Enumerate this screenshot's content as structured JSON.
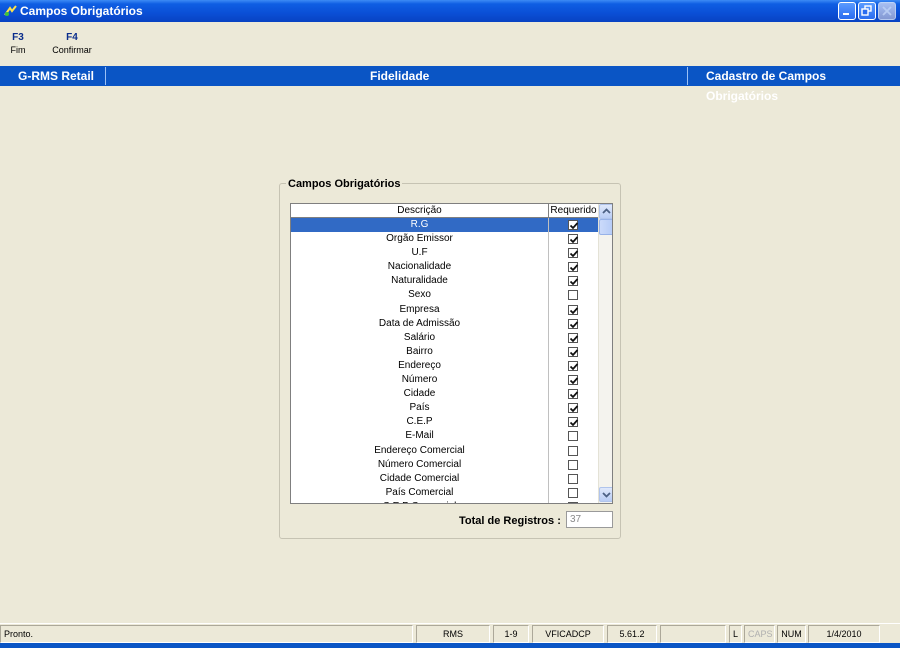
{
  "window": {
    "title": "Campos Obrigatórios",
    "controls": [
      "minimize",
      "maximize",
      "close"
    ]
  },
  "toolbar": {
    "items": [
      {
        "key": "F3",
        "label": "Fim"
      },
      {
        "key": "F4",
        "label": "Confirmar"
      }
    ]
  },
  "header": {
    "left": "G-RMS Retail",
    "center": "Fidelidade",
    "right": "Cadastro de Campos Obrigatórios"
  },
  "group": {
    "title": "Campos Obrigatórios",
    "columns": [
      "Descrição",
      "Requerido"
    ],
    "rows": [
      {
        "descricao": "R.G",
        "requerido": true,
        "selected": true
      },
      {
        "descricao": "Orgão Emissor",
        "requerido": true
      },
      {
        "descricao": "U.F",
        "requerido": true
      },
      {
        "descricao": "Nacionalidade",
        "requerido": true
      },
      {
        "descricao": "Naturalidade",
        "requerido": true
      },
      {
        "descricao": "Sexo",
        "requerido": false
      },
      {
        "descricao": "Empresa",
        "requerido": true
      },
      {
        "descricao": "Data de Admissão",
        "requerido": true
      },
      {
        "descricao": "Salário",
        "requerido": true
      },
      {
        "descricao": "Bairro",
        "requerido": true
      },
      {
        "descricao": "Endereço",
        "requerido": true
      },
      {
        "descricao": "Número",
        "requerido": true
      },
      {
        "descricao": "Cidade",
        "requerido": true
      },
      {
        "descricao": "País",
        "requerido": true
      },
      {
        "descricao": "C.E.P",
        "requerido": true
      },
      {
        "descricao": "E-Mail",
        "requerido": false
      },
      {
        "descricao": "Endereço Comercial",
        "requerido": false
      },
      {
        "descricao": "Número Comercial",
        "requerido": false
      },
      {
        "descricao": "Cidade Comercial",
        "requerido": false
      },
      {
        "descricao": "País Comercial",
        "requerido": false
      },
      {
        "descricao": "C.E.P Comercial",
        "requerido": false
      }
    ],
    "total_label": "Total de Registros :",
    "total_value": "37"
  },
  "statusbar": {
    "message": "Pronto.",
    "panels": [
      "RMS",
      "1-9",
      "VFICADCP",
      "5.61.2",
      "",
      "L",
      "CAPS",
      "NUM",
      "1/4/2010"
    ]
  },
  "colors": {
    "titlebar": "#0a4fd6",
    "header": "#0a55c5",
    "selection": "#316ac5",
    "background": "#ece9d8"
  }
}
